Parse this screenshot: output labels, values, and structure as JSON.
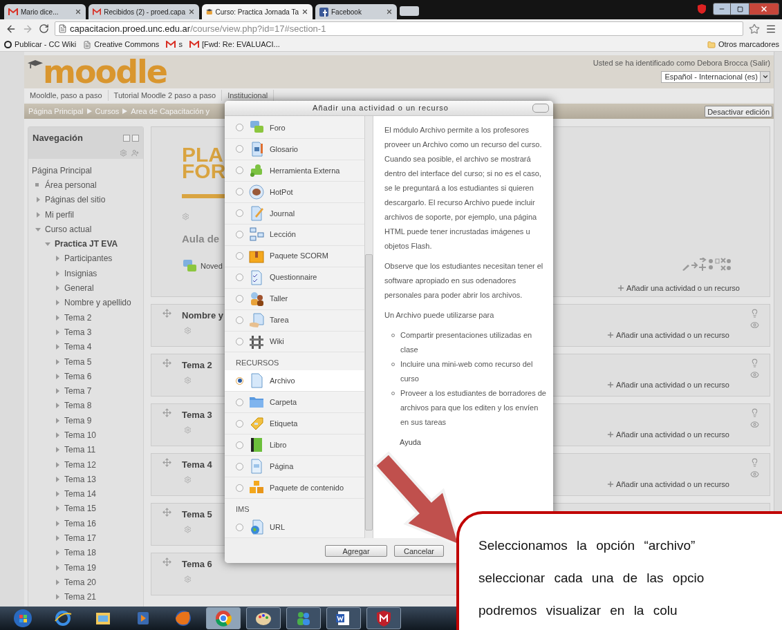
{
  "browser": {
    "tabs": [
      {
        "title": "Mario dice...",
        "selected": false
      },
      {
        "title": "Recibidos (2) - proed.capa",
        "selected": false
      },
      {
        "title": "Curso: Practica Jornada Ta",
        "selected": true
      },
      {
        "title": "Facebook",
        "selected": false
      }
    ],
    "url_host": "capacitacion.proed.unc.edu.ar",
    "url_path": "/course/view.php?id=17#section-1",
    "bookmarks": [
      "Publicar - CC Wiki",
      "Creative Commons",
      "s",
      "[Fwd: Re: EVALUACI..."
    ],
    "other_bookmarks": "Otros marcadores"
  },
  "header": {
    "logo": "moodle",
    "login": "Usted se ha identificado como Debora Brocca (Salir)",
    "language": "Español - Internacional (es)"
  },
  "custom_menu": [
    "Mooldle, paso a paso",
    "Tutorial Moodle 2 paso a paso",
    "Institucional"
  ],
  "breadcrumb": [
    "Página Principal",
    "Cursos",
    "Area de Capacitación y"
  ],
  "edit_button": "Desactivar edición",
  "navigation": {
    "title": "Navegación",
    "items": [
      {
        "label": "Página Principal",
        "kind": "link"
      },
      {
        "label": "Área personal",
        "kind": "leaf"
      },
      {
        "label": "Páginas del sitio",
        "kind": "branch",
        "expanded": false
      },
      {
        "label": "Mi perfil",
        "kind": "branch",
        "expanded": false
      },
      {
        "label": "Curso actual",
        "kind": "branch",
        "expanded": true,
        "children": [
          {
            "label": "Practica JT EVA",
            "kind": "branch",
            "expanded": true,
            "current": true,
            "children": [
              {
                "label": "Participantes",
                "kind": "branch",
                "expanded": false
              },
              {
                "label": "Insignias",
                "kind": "branch",
                "expanded": false
              },
              {
                "label": "General",
                "kind": "branch",
                "expanded": false
              },
              {
                "label": "Nombre y apellido",
                "kind": "branch",
                "expanded": false
              },
              {
                "label": "Tema 2",
                "kind": "branch",
                "expanded": false
              },
              {
                "label": "Tema 3",
                "kind": "branch",
                "expanded": false
              },
              {
                "label": "Tema 4",
                "kind": "branch",
                "expanded": false
              },
              {
                "label": "Tema 5",
                "kind": "branch",
                "expanded": false
              },
              {
                "label": "Tema 6",
                "kind": "branch",
                "expanded": false
              },
              {
                "label": "Tema 7",
                "kind": "branch",
                "expanded": false
              },
              {
                "label": "Tema 8",
                "kind": "branch",
                "expanded": false
              },
              {
                "label": "Tema 9",
                "kind": "branch",
                "expanded": false
              },
              {
                "label": "Tema 10",
                "kind": "branch",
                "expanded": false
              },
              {
                "label": "Tema 11",
                "kind": "branch",
                "expanded": false
              },
              {
                "label": "Tema 12",
                "kind": "branch",
                "expanded": false
              },
              {
                "label": "Tema 13",
                "kind": "branch",
                "expanded": false
              },
              {
                "label": "Tema 14",
                "kind": "branch",
                "expanded": false
              },
              {
                "label": "Tema 15",
                "kind": "branch",
                "expanded": false
              },
              {
                "label": "Tema 16",
                "kind": "branch",
                "expanded": false
              },
              {
                "label": "Tema 17",
                "kind": "branch",
                "expanded": false
              },
              {
                "label": "Tema 18",
                "kind": "branch",
                "expanded": false
              },
              {
                "label": "Tema 19",
                "kind": "branch",
                "expanded": false
              },
              {
                "label": "Tema 20",
                "kind": "branch",
                "expanded": false
              },
              {
                "label": "Tema 21",
                "kind": "branch",
                "expanded": false
              }
            ]
          }
        ]
      }
    ]
  },
  "course": {
    "banner": [
      "PLA",
      "FOR"
    ],
    "summary_title": "Aula de",
    "forum": "Noved",
    "add_link": "Añadir una actividad o un recurso"
  },
  "sections": [
    {
      "title": "Nombre y",
      "add_link": "Añadir una actividad o un recurso"
    },
    {
      "title": "Tema 2",
      "add_link": "Añadir una actividad o un recurso"
    },
    {
      "title": "Tema 3",
      "add_link": "Añadir una actividad o un recurso"
    },
    {
      "title": "Tema 4",
      "add_link": "Añadir una actividad o un recurso"
    },
    {
      "title": "Tema 5"
    },
    {
      "title": "Tema 6"
    }
  ],
  "dialog": {
    "title": "Añadir una actividad o un recurso",
    "options": [
      {
        "kind": "option",
        "label": "Foro",
        "selected": false
      },
      {
        "kind": "option",
        "label": "Glosario",
        "selected": false
      },
      {
        "kind": "option",
        "label": "Herramienta Externa",
        "selected": false
      },
      {
        "kind": "option",
        "label": "HotPot",
        "selected": false
      },
      {
        "kind": "option",
        "label": "Journal",
        "selected": false
      },
      {
        "kind": "option",
        "label": "Lección",
        "selected": false
      },
      {
        "kind": "option",
        "label": "Paquete SCORM",
        "selected": false
      },
      {
        "kind": "option",
        "label": "Questionnaire",
        "selected": false
      },
      {
        "kind": "option",
        "label": "Taller",
        "selected": false
      },
      {
        "kind": "option",
        "label": "Tarea",
        "selected": false
      },
      {
        "kind": "option",
        "label": "Wiki",
        "selected": false
      },
      {
        "kind": "heading",
        "label": "RECURSOS"
      },
      {
        "kind": "option",
        "label": "Archivo",
        "selected": true
      },
      {
        "kind": "option",
        "label": "Carpeta",
        "selected": false
      },
      {
        "kind": "option",
        "label": "Etiqueta",
        "selected": false
      },
      {
        "kind": "option",
        "label": "Libro",
        "selected": false
      },
      {
        "kind": "option",
        "label": "Página",
        "selected": false
      },
      {
        "kind": "option",
        "label": "Paquete de contenido",
        "selected": false
      },
      {
        "kind": "heading",
        "label": "IMS"
      },
      {
        "kind": "option",
        "label": "URL",
        "selected": false
      }
    ],
    "paragraphs": [
      "El módulo Archivo permite a los profesores proveer un Archivo como un recurso del curso. Cuando sea posible, el archivo se mostrará dentro del interface del curso; si no es el caso, se le preguntará a los estudiantes si quieren descargarlo. El recurso Archivo puede incluir archivos de soporte, por ejemplo, una página HTML puede tener incrustadas imágenes u objetos Flash.",
      "Observe que los estudiantes necesitan tener el software apropiado en sus odenadores personales para poder abrir los archivos.",
      "Un Archivo puede utilizarse para"
    ],
    "bullets": [
      "Compartir presentaciones utilizadas en clase",
      "Incluire una mini-web como recurso del curso",
      "Proveer a los estudiantes de borradores de archivos para que los editen y los envíen en sus tareas"
    ],
    "help": "Ayuda",
    "buttons": [
      "Agregar",
      "Cancelar"
    ]
  },
  "callout": [
    "Seleccionamos la opción “archivo”",
    "seleccionar cada una de las opcio",
    "podremos visualizar en la colu"
  ],
  "taskbar": [
    {
      "running": false,
      "selected": false
    },
    {
      "running": false,
      "selected": false
    },
    {
      "running": false,
      "selected": false
    },
    {
      "running": false,
      "selected": false
    },
    {
      "running": false,
      "selected": false
    },
    {
      "running": true,
      "selected": true
    },
    {
      "running": true,
      "selected": false
    },
    {
      "running": true,
      "selected": false
    },
    {
      "running": true,
      "selected": false
    },
    {
      "running": true,
      "selected": false
    }
  ]
}
